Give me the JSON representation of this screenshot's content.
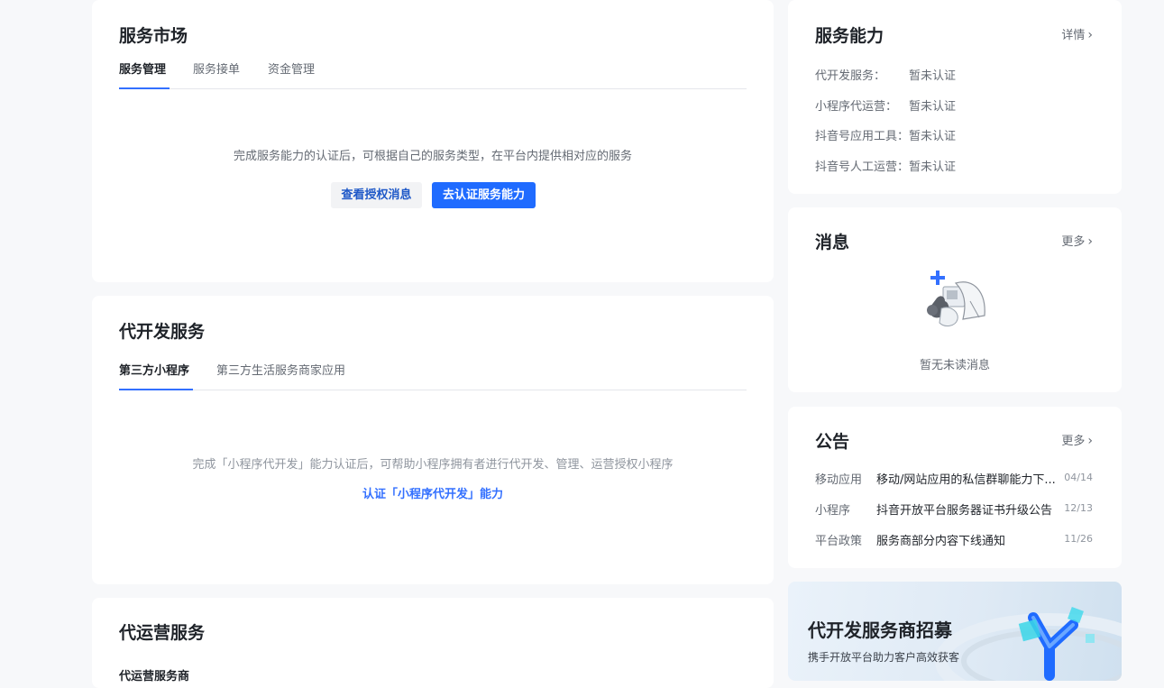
{
  "service_market": {
    "title": "服务市场",
    "tabs": [
      "服务管理",
      "服务接单",
      "资金管理"
    ],
    "empty_text": "完成服务能力的认证后，可根据自己的服务类型，在平台内提供相对应的服务",
    "btn_secondary": "查看授权消息",
    "btn_primary": "去认证服务能力"
  },
  "dev_service": {
    "title": "代开发服务",
    "tabs": [
      "第三方小程序",
      "第三方生活服务商家应用"
    ],
    "empty_text": "完成「小程序代开发」能力认证后，可帮助小程序拥有者进行代开发、管理、运营授权小程序",
    "link": "认证「小程序代开发」能力"
  },
  "ops_service": {
    "title": "代运营服务",
    "subtitle": "代运营服务商"
  },
  "abilities": {
    "title": "服务能力",
    "more": "详情",
    "rows": [
      {
        "label": "代开发服务：",
        "value": "暂未认证"
      },
      {
        "label": "小程序代运营：",
        "value": "暂未认证"
      },
      {
        "label": "抖音号应用工具：",
        "value": "暂未认证"
      },
      {
        "label": "抖音号人工运营：",
        "value": "暂未认证"
      }
    ]
  },
  "messages": {
    "title": "消息",
    "more": "更多",
    "empty": "暂无未读消息"
  },
  "notices": {
    "title": "公告",
    "more": "更多",
    "rows": [
      {
        "cat": "移动应用",
        "title": "移动/网站应用的私信群聊能力下...",
        "date": "04/14"
      },
      {
        "cat": "小程序",
        "title": "抖音开放平台服务器证书升级公告",
        "date": "12/13"
      },
      {
        "cat": "平台政策",
        "title": "服务商部分内容下线通知",
        "date": "11/26"
      }
    ]
  },
  "banner": {
    "title": "代开发服务商招募",
    "subtitle": "携手开放平台助力客户高效获客"
  },
  "colors": {
    "accent": "#3370ff",
    "primary_btn": "#1f6bff",
    "bg": "#f7f8fa"
  }
}
